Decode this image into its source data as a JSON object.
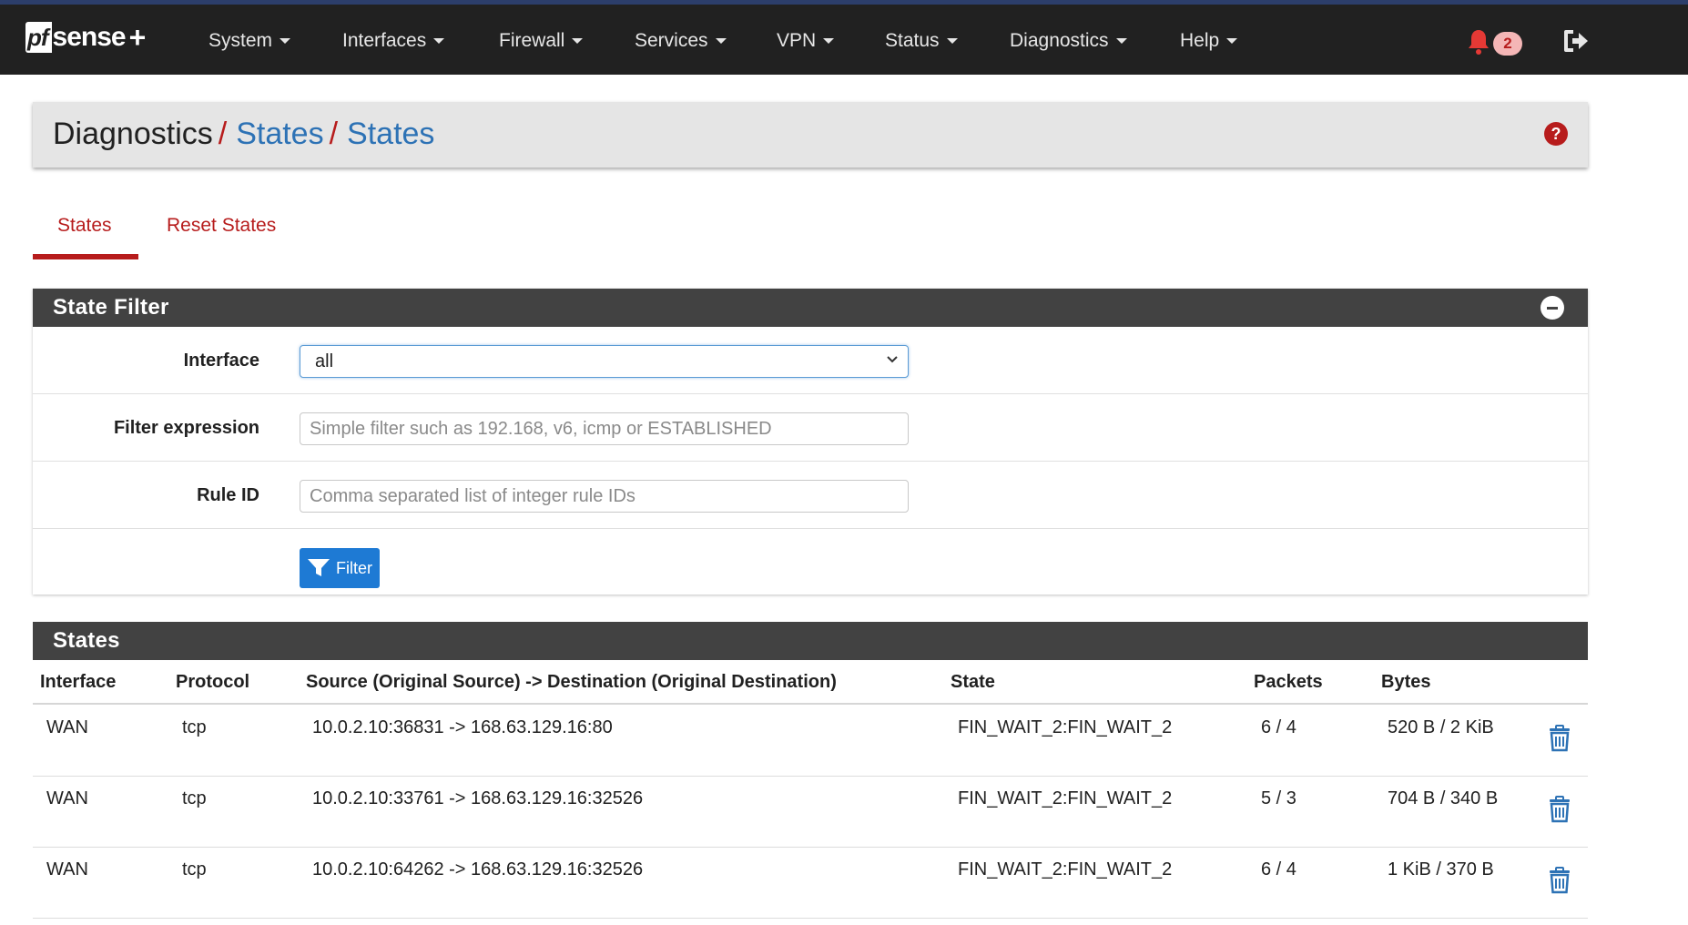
{
  "brand": {
    "pf": "pf",
    "sense": "sense",
    "plus": "+"
  },
  "nav": {
    "items": [
      {
        "label": "System"
      },
      {
        "label": "Interfaces"
      },
      {
        "label": "Firewall"
      },
      {
        "label": "Services"
      },
      {
        "label": "VPN"
      },
      {
        "label": "Status"
      },
      {
        "label": "Diagnostics"
      },
      {
        "label": "Help"
      }
    ],
    "notification_count": "2"
  },
  "breadcrumb": {
    "root": "Diagnostics",
    "sep": "/",
    "level1": "States",
    "level2": "States"
  },
  "help_glyph": "?",
  "tabs": [
    {
      "label": "States",
      "active": true
    },
    {
      "label": "Reset States",
      "active": false
    }
  ],
  "state_filter": {
    "title": "State Filter",
    "interface_label": "Interface",
    "interface_value": "all",
    "filter_expr_label": "Filter expression",
    "filter_expr_placeholder": "Simple filter such as 192.168, v6, icmp or ESTABLISHED",
    "filter_expr_value": "",
    "rule_id_label": "Rule ID",
    "rule_id_placeholder": "Comma separated list of integer rule IDs",
    "rule_id_value": "",
    "filter_button": "Filter"
  },
  "states": {
    "title": "States",
    "columns": [
      "Interface",
      "Protocol",
      "Source (Original Source) -> Destination (Original Destination)",
      "State",
      "Packets",
      "Bytes"
    ],
    "rows": [
      [
        "WAN",
        "tcp",
        "10.0.2.10:36831 -> 168.63.129.16:80",
        "FIN_WAIT_2:FIN_WAIT_2",
        "6 / 4",
        "520 B / 2 KiB"
      ],
      [
        "WAN",
        "tcp",
        "10.0.2.10:33761 -> 168.63.129.16:32526",
        "FIN_WAIT_2:FIN_WAIT_2",
        "5 / 3",
        "704 B / 340 B"
      ],
      [
        "WAN",
        "tcp",
        "10.0.2.10:64262 -> 168.63.129.16:32526",
        "FIN_WAIT_2:FIN_WAIT_2",
        "6 / 4",
        "1 KiB / 370 B"
      ]
    ]
  },
  "icons": {
    "bell": "bell-icon",
    "logout": "logout-icon",
    "help": "help-icon",
    "collapse": "minus-circle-icon",
    "filter": "filter-icon",
    "delete": "trash-icon"
  },
  "colors": {
    "navbar": "#212121",
    "accent_red": "#b71c1c",
    "link_blue": "#2d72b5",
    "panel_header": "#424242",
    "button_blue": "#1e7ad4"
  }
}
